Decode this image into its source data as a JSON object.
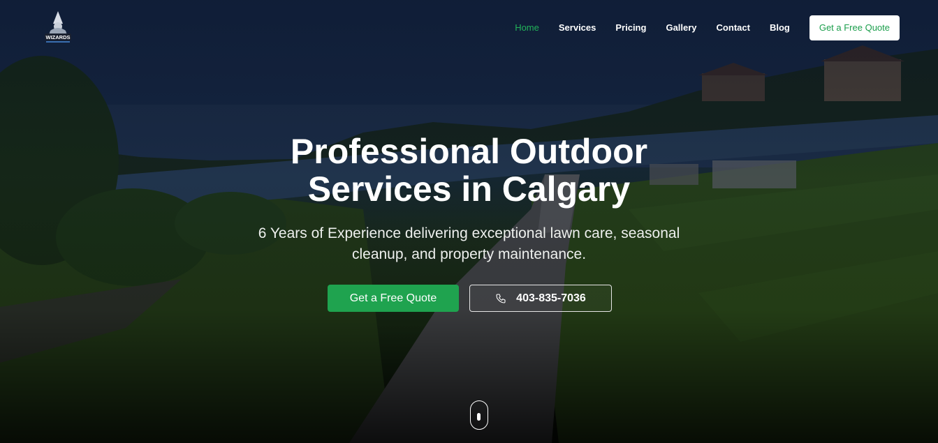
{
  "brand": {
    "logo_icon": "wizard-logo-icon",
    "logo_text": "WIZARDS"
  },
  "nav": {
    "items": [
      {
        "label": "Home",
        "active": true
      },
      {
        "label": "Services",
        "active": false
      },
      {
        "label": "Pricing",
        "active": false
      },
      {
        "label": "Gallery",
        "active": false
      },
      {
        "label": "Contact",
        "active": false
      },
      {
        "label": "Blog",
        "active": false
      }
    ],
    "cta_label": "Get a Free Quote"
  },
  "hero": {
    "title_line1": "Professional Outdoor",
    "title_line2": "Services in Calgary",
    "subtitle_line1": "6 Years of Experience delivering exceptional lawn care, seasonal",
    "subtitle_line2": "cleanup, and property maintenance.",
    "primary_button": "Get a Free Quote",
    "phone_button": "403-835-7036",
    "phone_icon": "phone-icon",
    "scroll_icon": "mouse-scroll-icon"
  },
  "colors": {
    "accent": "#1fa34f",
    "nav_active": "#22b35a",
    "text": "#ffffff"
  }
}
